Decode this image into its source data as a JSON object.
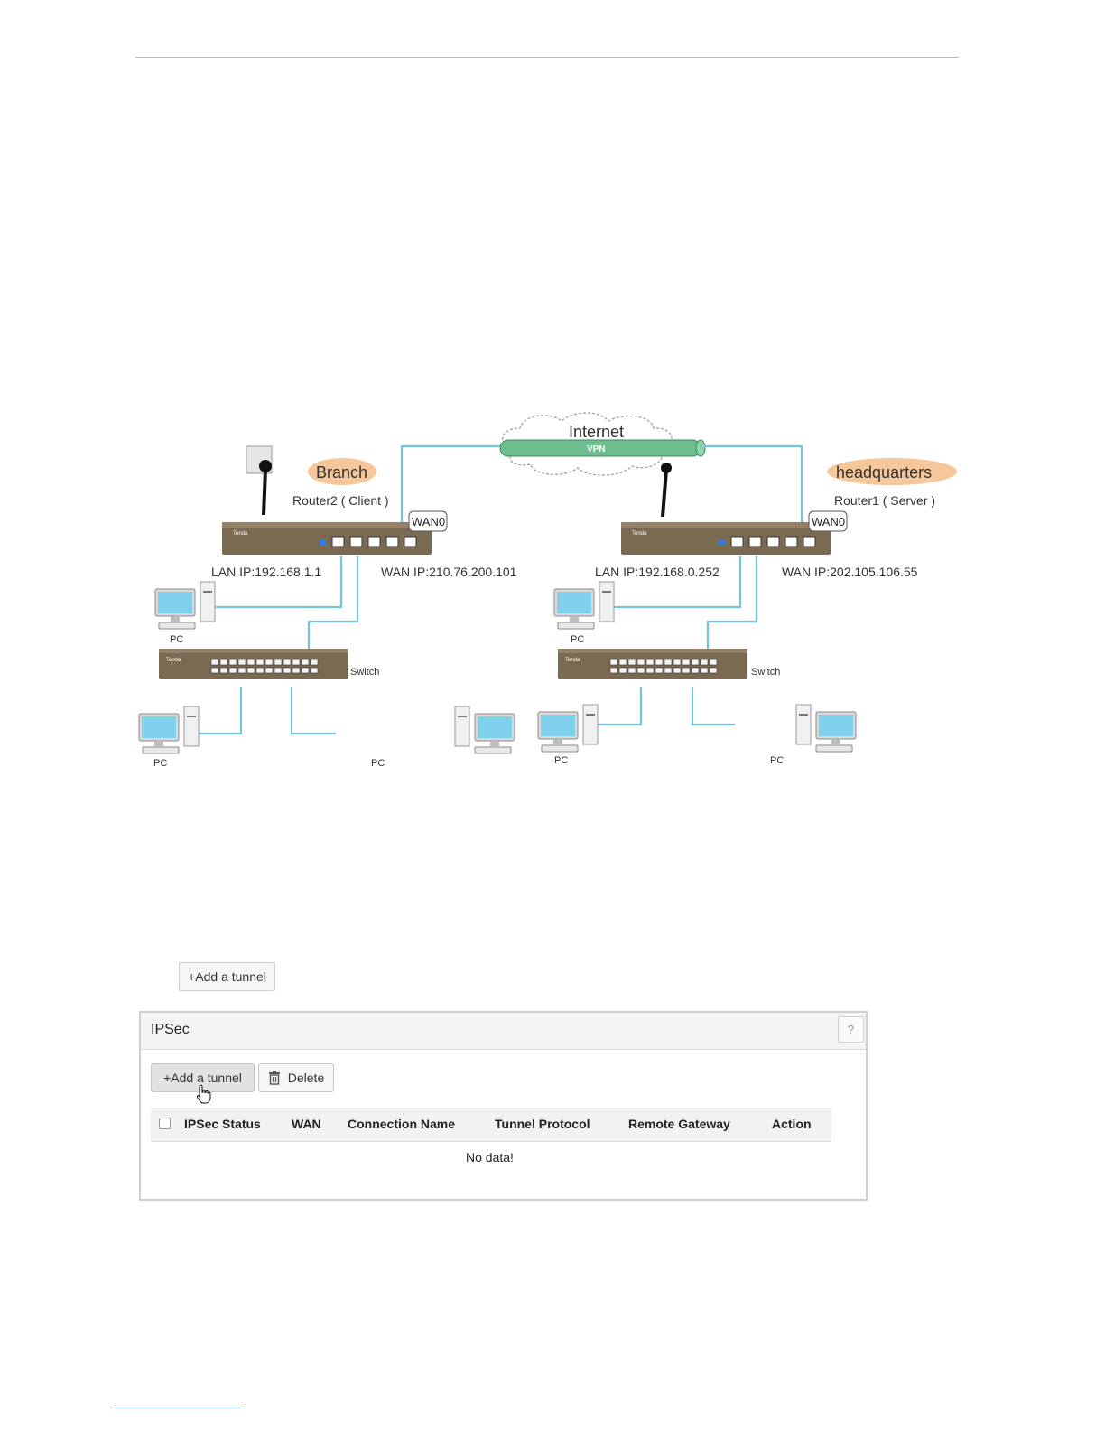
{
  "diagram": {
    "internet_label": "Internet",
    "vpn_label": "VPN",
    "branch": {
      "tag": "Branch",
      "router_label": "Router2 ( Client )",
      "wan_port": "WAN0",
      "lan_ip": "LAN IP:192.168.1.1",
      "wan_ip": "WAN IP:210.76.200.101",
      "pc_label": "PC",
      "switch_label": "Switch"
    },
    "hq": {
      "tag": "headquarters",
      "router_label": "Router1 ( Server )",
      "wan_port": "WAN0",
      "lan_ip": "LAN IP:192.168.0.252",
      "wan_ip": "WAN IP:202.105.106.55",
      "pc_label": "PC",
      "switch_label": "Switch"
    },
    "device_brand": "Tenda",
    "colors": {
      "cable": "#72c5dc",
      "tag_fill": "#f5c79a",
      "router_body": "#7b6a52",
      "vpn_tube": "#6dbd8f"
    }
  },
  "inline_button": {
    "label": "+Add a tunnel"
  },
  "ipsec": {
    "title": "IPSec",
    "help": "?",
    "add_button": "+Add a tunnel",
    "delete_button": "Delete",
    "columns": [
      "IPSec Status",
      "WAN",
      "Connection Name",
      "Tunnel Protocol",
      "Remote Gateway",
      "Action"
    ],
    "empty_text": "No data!"
  }
}
